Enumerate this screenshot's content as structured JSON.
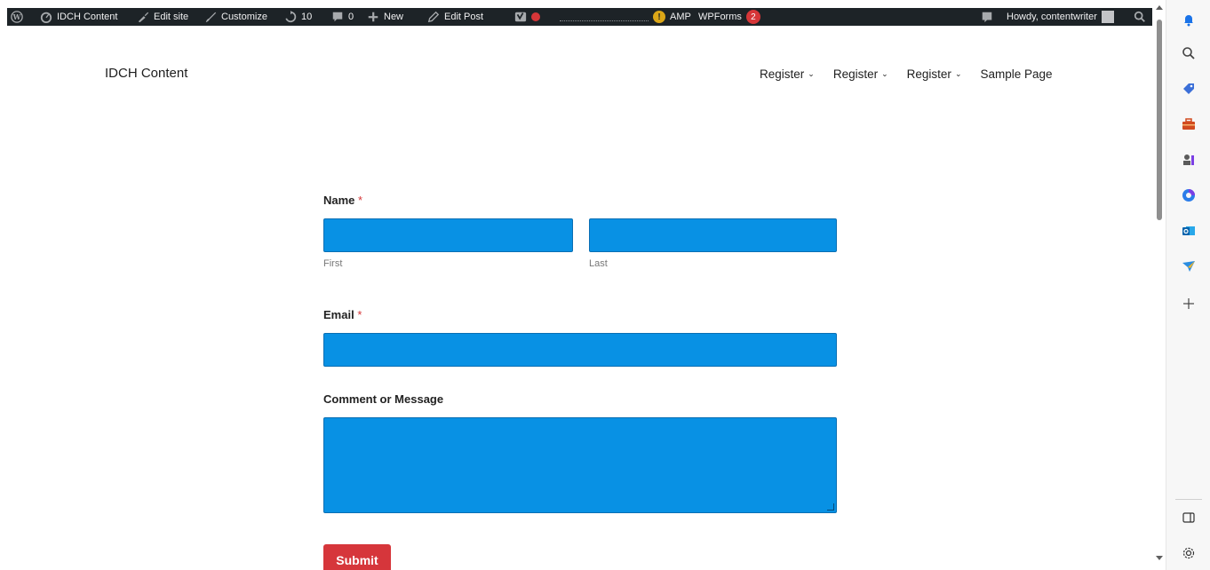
{
  "admin_bar": {
    "site_name": "IDCH Content",
    "edit_site": "Edit site",
    "customize": "Customize",
    "updates_count": "10",
    "comments_count": "0",
    "new_label": "New",
    "edit_post": "Edit Post",
    "amp_label": "AMP",
    "wpforms_label": "WPForms",
    "wpforms_badge": "2",
    "howdy": "Howdy, contentwriter"
  },
  "site": {
    "title": "IDCH Content",
    "nav": [
      {
        "label": "Register",
        "chevron": "⌄"
      },
      {
        "label": "Register",
        "chevron": "⌄"
      },
      {
        "label": "Register",
        "chevron": "⌄"
      },
      {
        "label": "Sample Page"
      }
    ]
  },
  "form": {
    "name_label": "Name",
    "required_mark": "*",
    "first_sublabel": "First",
    "last_sublabel": "Last",
    "email_label": "Email",
    "message_label": "Comment or Message",
    "submit_label": "Submit"
  },
  "colors": {
    "field_bg": "#0891e4",
    "submit_bg": "#d6363b",
    "admin_bar_bg": "#1d2327",
    "required": "#d63638"
  },
  "edge_sidebar": {
    "icons": [
      "bell-icon",
      "search-icon",
      "tag-icon",
      "briefcase-icon",
      "chess-icon",
      "copilot-icon",
      "outlook-icon",
      "send-icon",
      "plus-icon",
      "sidebar-toggle-icon",
      "settings-icon"
    ]
  }
}
